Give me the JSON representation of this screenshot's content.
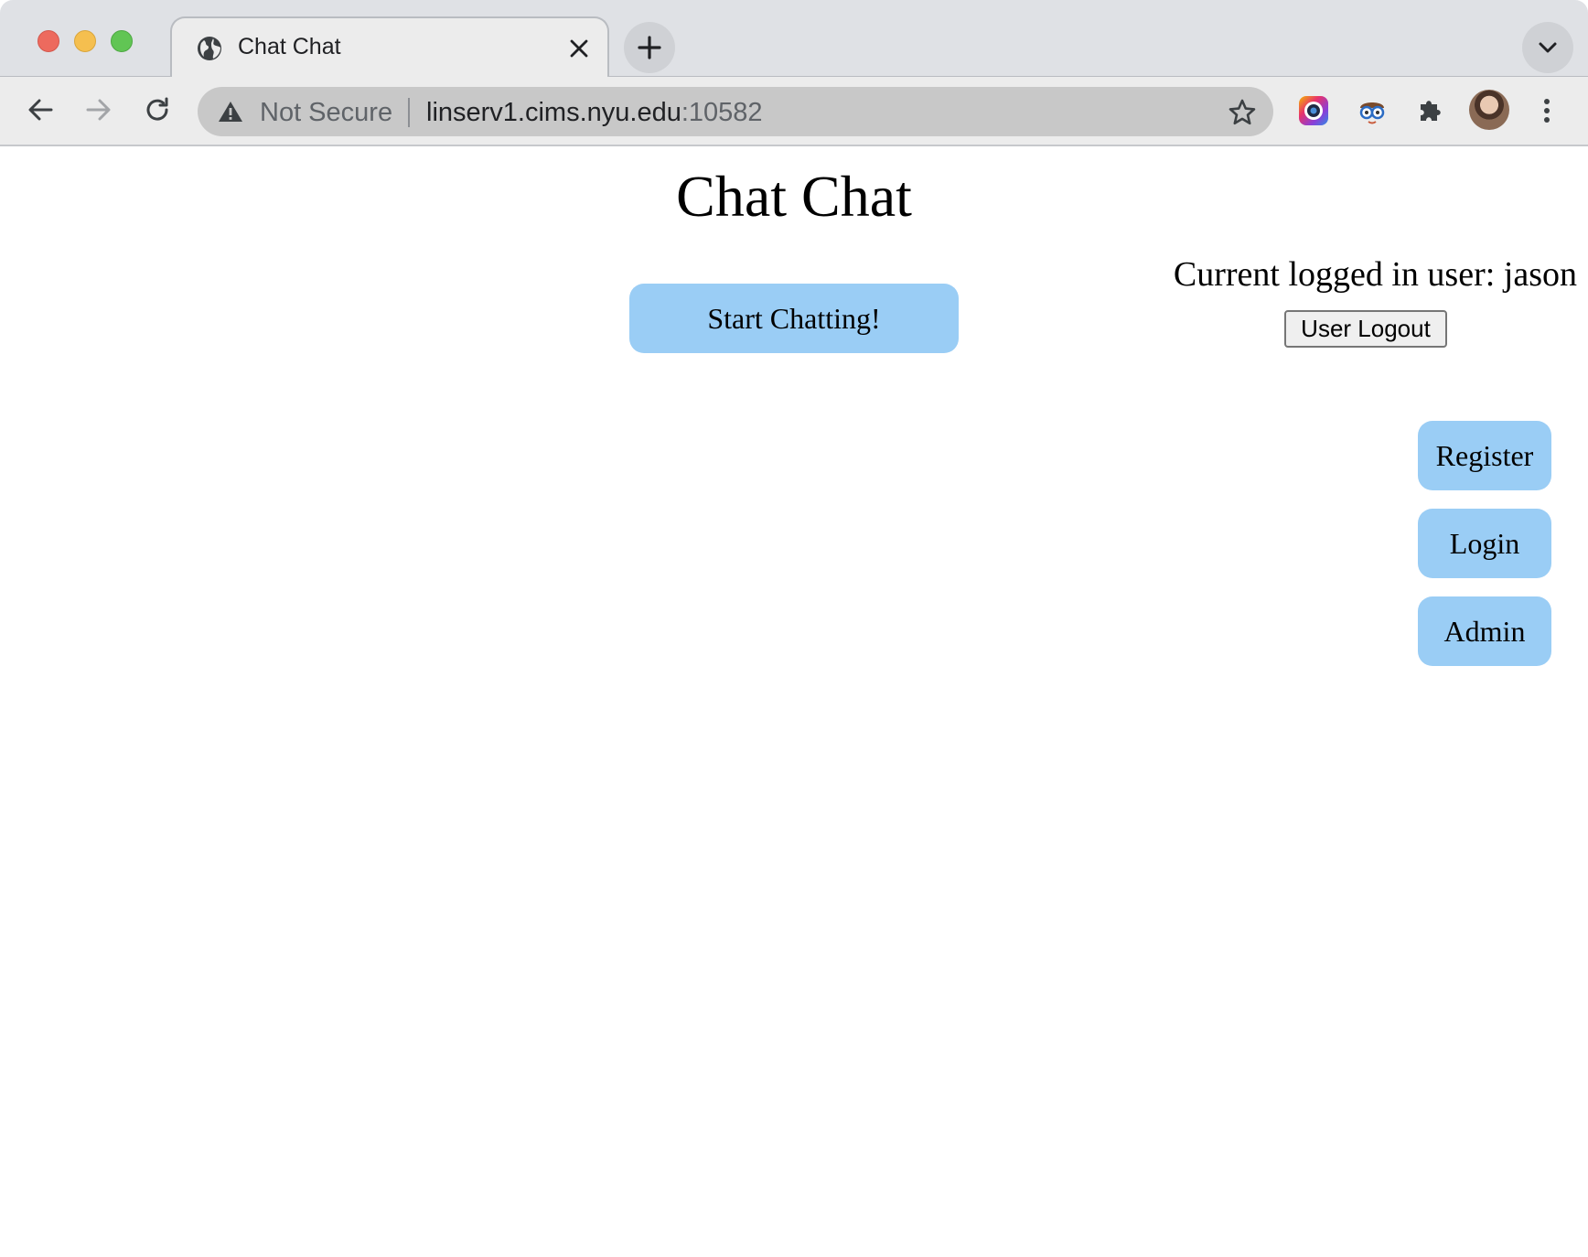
{
  "browser": {
    "tab": {
      "title": "Chat Chat",
      "icon": "globe-icon"
    },
    "address_bar": {
      "security_label": "Not Secure",
      "url_host": "linserv1.cims.nyu.edu",
      "url_port": ":10582"
    },
    "colors": {
      "traffic_red": "#ed6a5e",
      "traffic_yellow": "#f5bf4f",
      "traffic_green": "#61c554"
    },
    "extensions": [
      "camera-extension-icon",
      "glasses-extension-icon",
      "puzzle-extensions-icon"
    ]
  },
  "page": {
    "title": "Chat Chat",
    "start_button": "Start Chatting!",
    "logged_in_text": "Current logged in user: jason",
    "logout_button": "User Logout",
    "side_buttons": {
      "register": "Register",
      "login": "Login",
      "admin": "Admin"
    },
    "colors": {
      "button_blue": "#9acdf5"
    }
  }
}
